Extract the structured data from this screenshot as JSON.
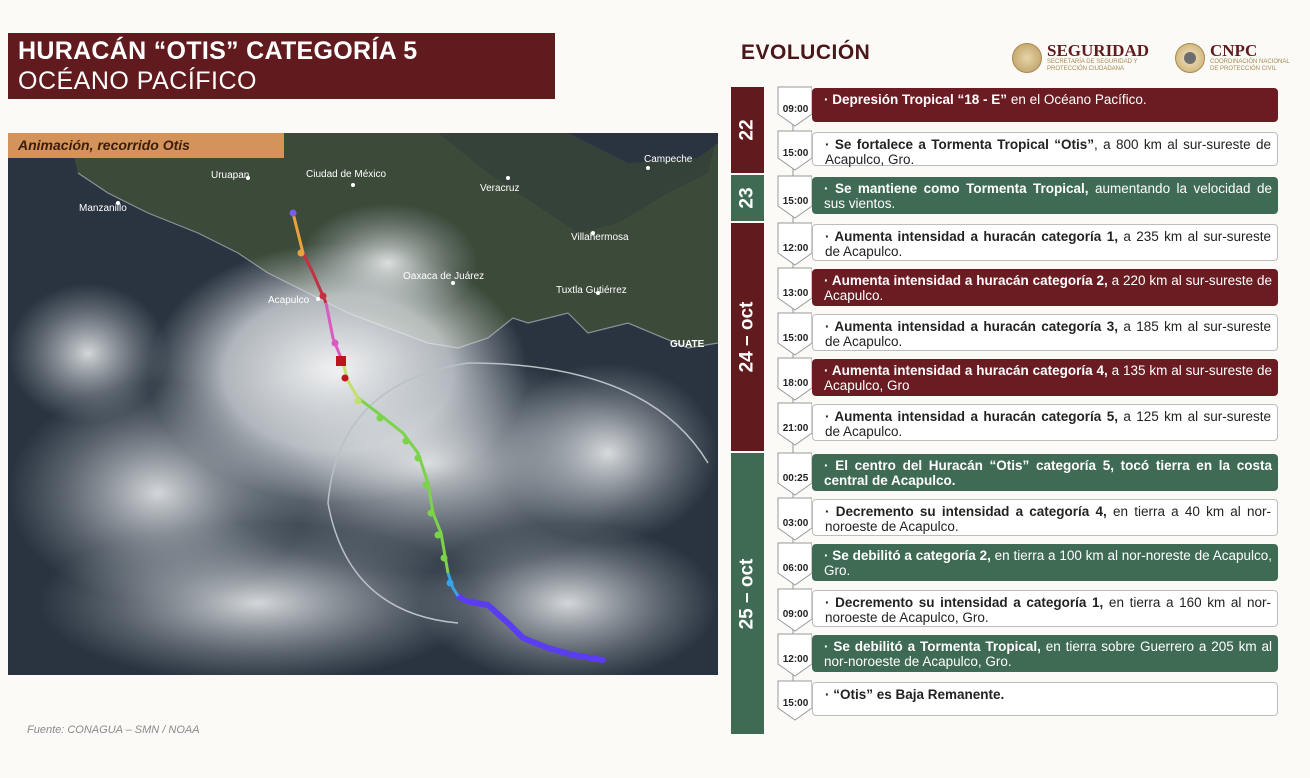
{
  "header": {
    "title_line1": "HURACÁN “OTIS” CATEGORÍA 5",
    "title_line2": "OCÉANO PACÍFICO"
  },
  "map": {
    "label": "Animación, recorrido Otis",
    "places": {
      "uruapan": "Uruapan",
      "ciudad_mexico": "Ciudad de México",
      "campeche": "Campeche",
      "manzanillo": "Manzanillo",
      "veracruz": "Veracruz",
      "villahermosa": "Villahermosa",
      "oaxaca": "Oaxaca de Juárez",
      "tuxtla": "Tuxtla Gutiérrez",
      "acapulco": "Acapulco",
      "guate": "GUATE"
    },
    "source": "Fuente: CONAGUA – SMN / NOAA"
  },
  "logos": {
    "seguridad": "SEGURIDAD",
    "seguridad_sub": "SECRETARÍA DE SEGURIDAD Y PROTECCIÓN CIUDADANA",
    "cnpc": "CNPC",
    "cnpc_sub": "COORDINACIÓN NACIONAL DE PROTECCIÓN CIVIL"
  },
  "evolution": {
    "title": "EVOLUCIÓN",
    "days": [
      {
        "label": "22"
      },
      {
        "label": "23"
      },
      {
        "label": "24 – oct"
      },
      {
        "label": "25 – oct"
      }
    ],
    "events": [
      {
        "time": "09:00",
        "bold": "Depresión Tropical “18 - E”",
        "text": " en el Océano Pacífico.",
        "style": "maroon"
      },
      {
        "time": "15:00",
        "bold": "Se fortalece a Tormenta Tropical “Otis”",
        "text": ", a 800 km al sur-sureste de Acapulco, Gro.",
        "style": "white"
      },
      {
        "time": "15:00",
        "bold": "Se mantiene como Tormenta Tropical,",
        "text": " aumentando la velocidad de sus vientos.",
        "style": "green"
      },
      {
        "time": "12:00",
        "bold": "Aumenta intensidad a huracán categoría 1,",
        "text": " a 235 km al sur-sureste de Acapulco.",
        "style": "white"
      },
      {
        "time": "13:00",
        "bold": "Aumenta intensidad a huracán categoría 2,",
        "text": " a 220 km al sur-sureste de Acapulco.",
        "style": "maroon"
      },
      {
        "time": "15:00",
        "bold": "Aumenta intensidad a huracán categoría 3,",
        "text": " a 185 km al sur-sureste de Acapulco.",
        "style": "white"
      },
      {
        "time": "18:00",
        "bold": "Aumenta intensidad a huracán categoría 4,",
        "text": " a 135 km al sur-sureste de Acapulco, Gro",
        "style": "maroon"
      },
      {
        "time": "21:00",
        "bold": "Aumenta intensidad a huracán categoría 5,",
        "text": " a 125 km al sur-sureste de Acapulco.",
        "style": "white"
      },
      {
        "time": "00:25",
        "bold": "El centro del Huracán “Otis” categoría 5, tocó tierra en la costa central de Acapulco.",
        "text": "",
        "style": "green"
      },
      {
        "time": "03:00",
        "bold": "Decremento su intensidad a categoría 4,",
        "text": " en tierra a 40 km al nor-noroeste de Acapulco.",
        "style": "white"
      },
      {
        "time": "06:00",
        "bold": "Se debilitó a categoría 2,",
        "text": " en tierra a 100 km al nor-noreste de Acapulco, Gro.",
        "style": "green"
      },
      {
        "time": "09:00",
        "bold": "Decremento su intensidad a categoría 1,",
        "text": " en tierra a 160 km al nor-noroeste de Acapulco, Gro.",
        "style": "white"
      },
      {
        "time": "12:00",
        "bold": "Se debilitó a Tormenta Tropical,",
        "text": " en tierra sobre Guerrero a 205 km al nor-noroeste de Acapulco, Gro.",
        "style": "green"
      },
      {
        "time": "15:00",
        "bold": "“Otis” es Baja Remanente.",
        "text": "",
        "style": "white"
      }
    ]
  },
  "colors": {
    "maroon": "#611a1d",
    "green": "#3f6b54",
    "accent_orange": "#d4935a"
  }
}
